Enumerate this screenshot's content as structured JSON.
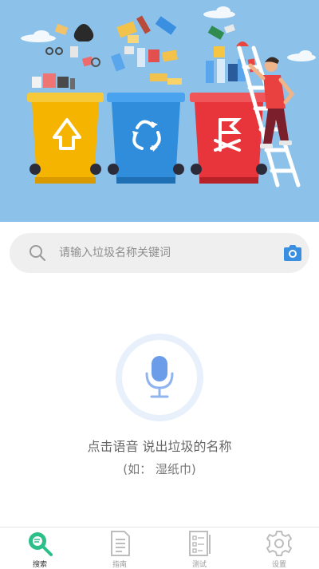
{
  "hero": {
    "image": "garbage-sorting-banner"
  },
  "search": {
    "placeholder": "请输入垃圾名称关键词",
    "value": "",
    "left_icon": "search-icon",
    "right_icon": "camera-icon"
  },
  "voice": {
    "icon": "microphone-icon",
    "prompt": "点击语音 说出垃圾的名称",
    "example": "(如：  湿纸巾)"
  },
  "tabs": [
    {
      "label": "搜索",
      "icon": "search-tab-icon",
      "active": true
    },
    {
      "label": "指南",
      "icon": "guide-document-icon",
      "active": false
    },
    {
      "label": "测试",
      "icon": "test-checklist-icon",
      "active": false
    },
    {
      "label": "设置",
      "icon": "gear-icon",
      "active": false
    }
  ],
  "colors": {
    "accent_green": "#2bbf8a",
    "hero_sky": "#8cc1ea",
    "bin_yellow": "#f5b400",
    "bin_blue": "#2f8ddc",
    "bin_red": "#e8343b",
    "camera_blue": "#3a8fe0",
    "mic_blue": "#6c9de8"
  }
}
